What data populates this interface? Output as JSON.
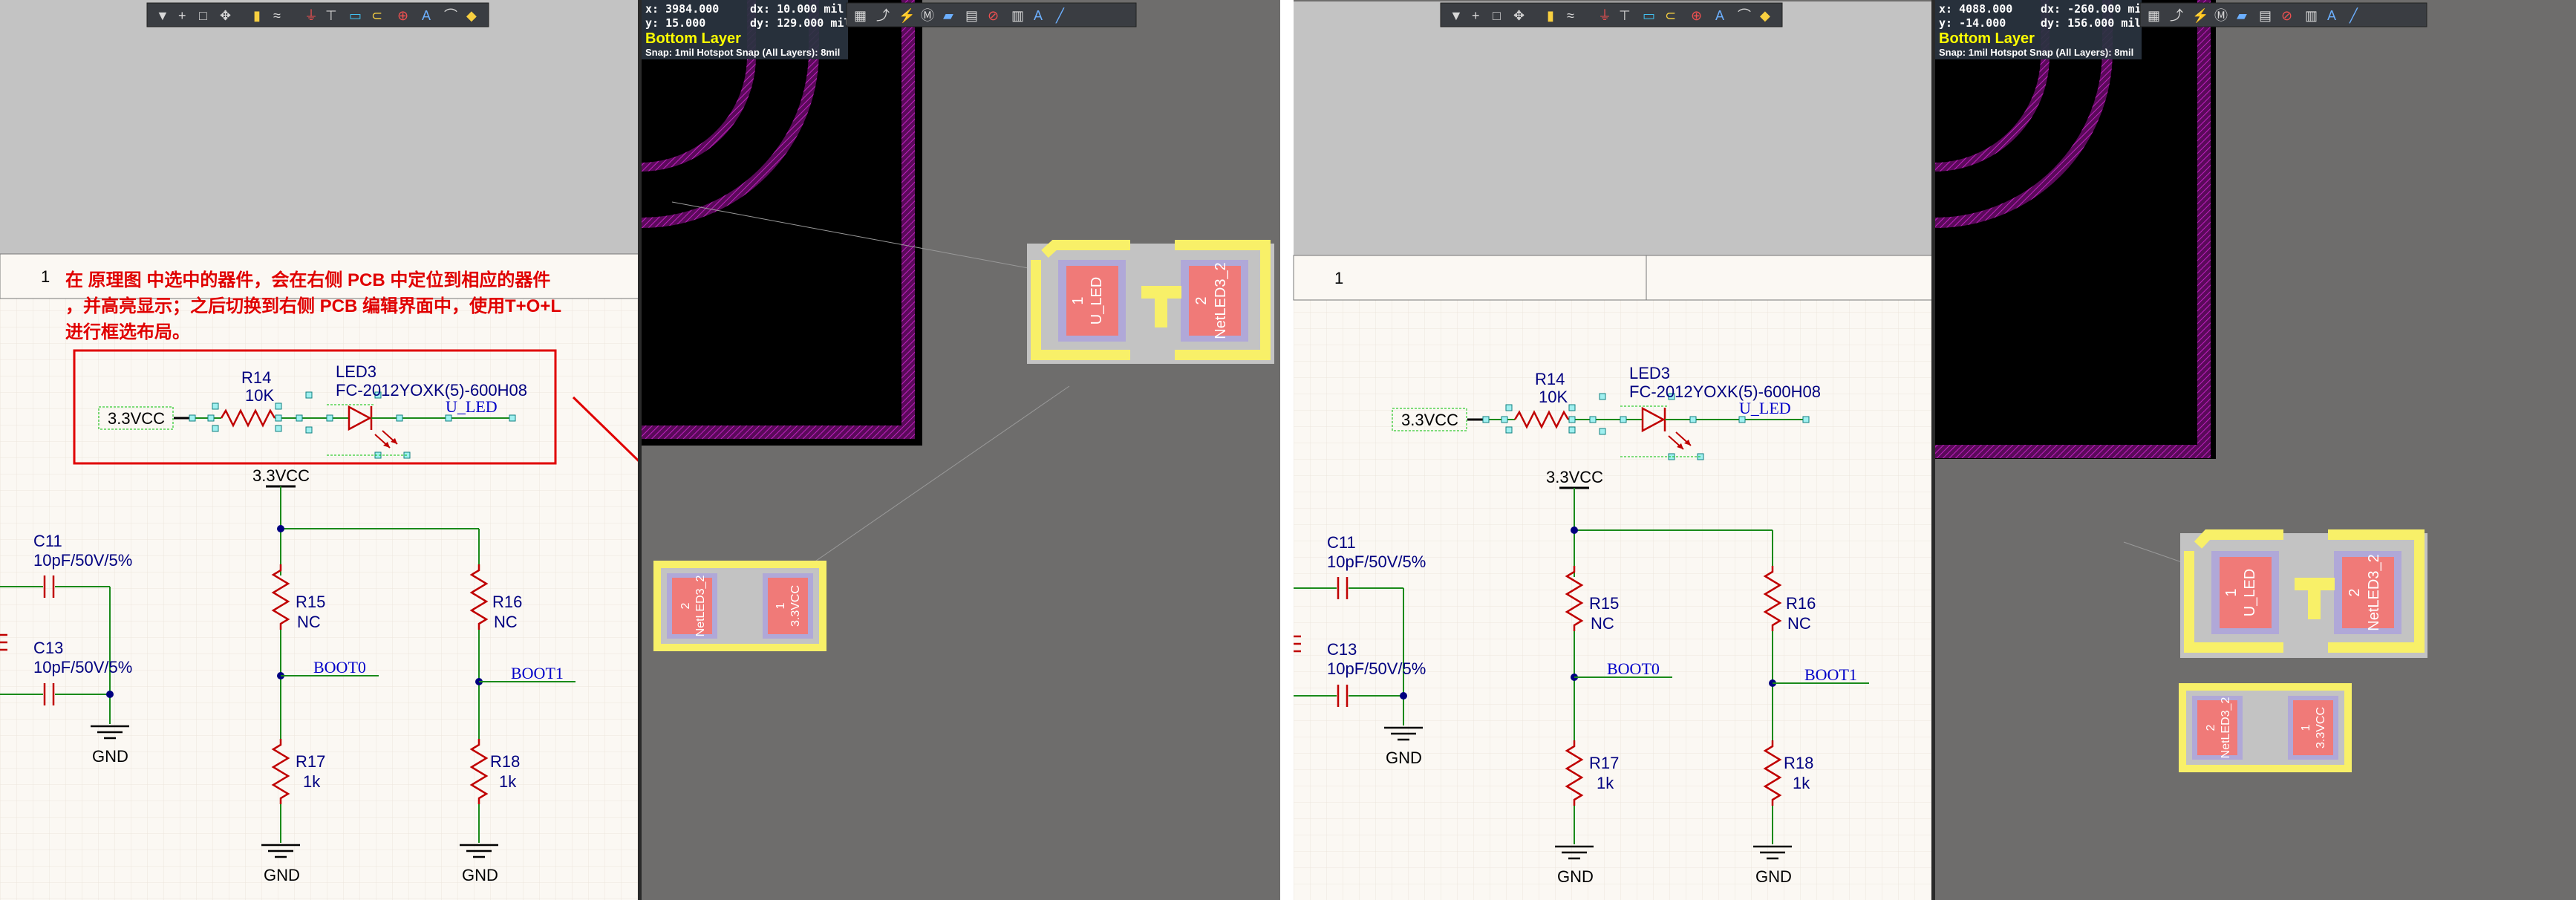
{
  "colors": {
    "schematic_bg": "#fbf8f3",
    "schematic_top": "#c3c3c3",
    "grid": "#ece6dc",
    "wire": "#1a8a1a",
    "component": "#c00000",
    "text_blue": "#000080",
    "net_label": "#0000c8",
    "pcb_board": "#000000",
    "pcb_bg": "#6e6d6c",
    "keepout": "#b010b0",
    "pad": "#f07a78",
    "silk": "#f8f068",
    "layer_text": "#ffff00",
    "annotation": "#e00000"
  },
  "annotation": {
    "line1": "在 原理图 中选中的器件，会在右侧 PCB 中定位到相应的器件",
    "line2": "，并高亮显示；之后切换到右侧 PCB 编辑界面中，使用T+O+L",
    "line3": "进行框选布局。"
  },
  "schematic_toolbar": {
    "icons": [
      "filter-icon",
      "add-icon",
      "rect-select-icon",
      "move-icon",
      "align-icon",
      "wire-icon",
      "bus-icon",
      "power-icon",
      "gnd-icon",
      "component-icon",
      "net-label-icon",
      "port-icon",
      "no-erc-icon",
      "text-icon",
      "arc-icon",
      "flag-icon"
    ]
  },
  "pcb_toolbar": {
    "icons": [
      "filter-icon",
      "add-icon",
      "rect-select-icon",
      "move-icon",
      "align-icon",
      "chart-icon",
      "route-icon",
      "interactive-icon",
      "via-icon",
      "pad-icon",
      "fill-icon",
      "poly-icon",
      "keepout-icon",
      "chart2-icon",
      "text-icon",
      "line-icon"
    ]
  },
  "left": {
    "title_block_number": "1",
    "sheet": {
      "vcc_port": "3.3VCC",
      "r14_name": "R14",
      "r14_value": "10K",
      "led3_name": "LED3",
      "led3_part": "FC-2012YOXK(5)-600H08",
      "u_led": "U_LED",
      "vcc_power": "3.3VCC",
      "c11_name": "C11",
      "c11_value": "10pF/50V/5%",
      "c13_name": "C13",
      "c13_value": "10pF/50V/5%",
      "r15_name": "R15",
      "r15_value": "NC",
      "r16_name": "R16",
      "r16_value": "NC",
      "boot0": "BOOT0",
      "boot1": "BOOT1",
      "r17_name": "R17",
      "r17_value": "1k",
      "r18_name": "R18",
      "r18_value": "1k",
      "gnd1": "GND",
      "gnd2": "GND",
      "gnd3": "GND"
    },
    "pcb": {
      "x": "x:  3984.000",
      "dx": "dx:   10.000  mil",
      "y": "y:   15.000",
      "dy": "dy:  129.000 mil",
      "layer": "Bottom Layer",
      "snap": "Snap: 1mil Hotspot Snap (All Layers): 8mil",
      "big_pad1_num": "1",
      "big_pad1_net": "U_LED",
      "big_pad2_num": "2",
      "big_pad2_net": "NetLED3_2",
      "small_pad1_num": "2",
      "small_pad1_net": "NetLED3_2",
      "small_pad2_num": "1",
      "small_pad2_net": "3.3VCC"
    }
  },
  "right": {
    "title_block_number": "1",
    "sheet": {
      "vcc_port": "3.3VCC",
      "r14_name": "R14",
      "r14_value": "10K",
      "led3_name": "LED3",
      "led3_part": "FC-2012YOXK(5)-600H08",
      "u_led": "U_LED",
      "vcc_power": "3.3VCC",
      "c11_name": "C11",
      "c11_value": "10pF/50V/5%",
      "c13_name": "C13",
      "c13_value": "10pF/50V/5%",
      "r15_name": "R15",
      "r15_value": "NC",
      "r16_name": "R16",
      "r16_value": "NC",
      "boot0": "BOOT0",
      "boot1": "BOOT1",
      "r17_name": "R17",
      "r17_value": "1k",
      "r18_name": "R18",
      "r18_value": "1k",
      "gnd1": "GND",
      "gnd2": "GND",
      "gnd3": "GND"
    },
    "pcb": {
      "x": "x:  4088.000",
      "dx": "dx:  -260.000 mil",
      "y": "y:  -14.000",
      "dy": "dy:  156.000 mil",
      "layer": "Bottom Layer",
      "snap": "Snap: 1mil Hotspot Snap (All Layers): 8mil",
      "big_pad1_num": "1",
      "big_pad1_net": "U_LED",
      "big_pad2_num": "2",
      "big_pad2_net": "NetLED3_2",
      "small_pad1_num": "2",
      "small_pad1_net": "NetLED3_2",
      "small_pad2_num": "1",
      "small_pad2_net": "3.3VCC"
    }
  }
}
